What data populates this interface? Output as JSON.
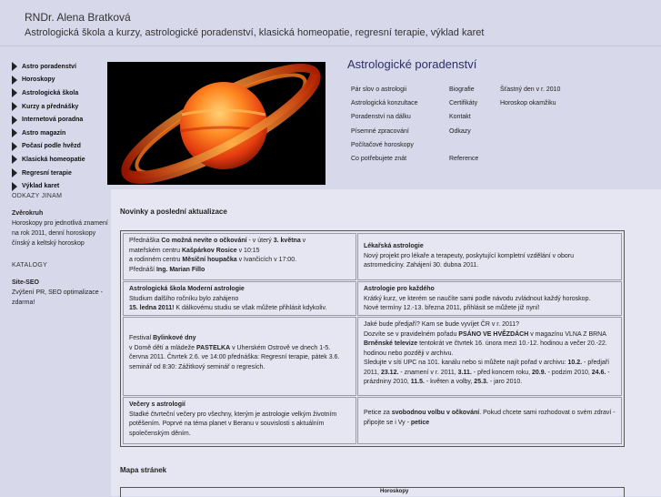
{
  "header": {
    "name": "RNDr. Alena Bratková",
    "tagline": "Astrologická škola a kurzy, astrologické poradenství, klasická homeopatie, regresní terapie, výklad karet"
  },
  "nav": [
    "Astro poradenství",
    "Horoskopy",
    "Astrologická škola",
    "Kurzy a přednášky",
    "Internetová poradna",
    "Astro magazín",
    "Počasí podle hvězd",
    "Klasická homeopatie",
    "Regresní terapie",
    "Výklad karet"
  ],
  "section": {
    "title": "Astrologické poradenství",
    "col1": [
      "Pár slov o astrologii",
      "Astrologická konzultace",
      "Poradenství na dálku",
      "Písemné zpracování",
      "Počítačové horoskopy",
      "Co potřebujete znát"
    ],
    "col2": [
      "Biografie",
      "Certifikáty",
      "Kontakt",
      "Odkazy",
      "",
      "Reference"
    ],
    "col3": [
      "Šťastný den v r. 2010",
      "Horoskop okamžiku"
    ]
  },
  "sidebar": {
    "heading1": "ODKAZY JINAM",
    "link1_title": "Zvěrokruh",
    "link1_text": "Horoskopy pro jednotlivá znamení na rok 2011, denní horoskopy čínský a keltský horoskop",
    "heading2": "KATALOGY",
    "link2_title": "Site-SEO",
    "link2_text": "Zvýšení PR, SEO optimalizace - zdarma!"
  },
  "main": {
    "news_title": "Novinky a poslední aktualizace",
    "sitemap_title": "Mapa stránek",
    "sitemap_col_label": "Horoskopy"
  },
  "news": {
    "c1": {
      "line1a": "Přednáška ",
      "line1b": "Co možná nevíte o očkování",
      "line1c": " - v úterý ",
      "line1d": "3. května",
      "line1e": " v",
      "line2a": "mateřském centru ",
      "line2b": "Kašpárkov Rosice",
      "line2c": " v 10:15",
      "line3a": "a rodinném centru ",
      "line3b": "Měsíční houpačka",
      "line3c": " v Ivančicích v 17:00.",
      "line4a": "Přednáší ",
      "line4b": "Ing. Marian Fillo"
    },
    "c2": {
      "title": "Lékařská astrologie",
      "text": "Nový projekt pro lékaře a terapeuty, poskytující kompletní vzdělání v oboru astromedicíny. Zahájení 30. dubna 2011."
    },
    "c3": {
      "title": "Astrologická škola Moderní astrologie",
      "text1": "Studium dalšího ročníku bylo zahájeno",
      "date": "15. ledna 2011!",
      "text2": " K dálkovému studiu se však můžete přihlásit kdykoliv."
    },
    "c4": {
      "title": "Astrologie pro každého",
      "text1": "Krátký kurz, ve kterém se naučíte sami podle návodu zvládnout každý horoskop.",
      "text2": "Nové termíny 12.-13. března 2011, přihlásit se můžete již nyní!"
    },
    "c5": {
      "a": "Festival ",
      "b": "Bylinkové dny",
      "c": "v Domě dětí a mládeže ",
      "d": "PASTELKA",
      "e": " v Uherském Ostrově ve dnech 1-5. června 2011. Čtvrtek 2.6. ve 14:00 přednáška: Regresní terapie, pátek 3.6. seminář od 8:30: Zážitkový seminář o regresích."
    },
    "c6": {
      "q": "Jaké bude předjaří? Kam se bude vyvíjet ČR v r. 2011?",
      "a1": "Dozvíte se v pravidelném pořadu ",
      "a2": "PSÁNO VE HVĚZDÁCH",
      "a3": " v magazínu VLNA Z BRNA ",
      "b1": "Brněnské televize",
      "b2": " tentokrát ve čtvrtek 16. února mezi 10.-12. hodinou a večer 20.-22. hodinou nebo později v archivu.",
      "c1": "Sledujte v síti UPC na 101. kanálu nebo si můžete najít pořad v archivu: ",
      "d1": "10.2.",
      "d2": " - předjaří 2011, ",
      "d3": "23.12.",
      "d4": " - znamení v r. 2011, ",
      "d5": "3.11.",
      "d6": " - před koncem roku, ",
      "d7": "20.9.",
      "d8": " - podzim 2010, ",
      "d9": "24.6.",
      "d10": " - prázdniny 2010, ",
      "d11": "11.5.",
      "d12": " - květen a volby, ",
      "d13": "25.3.",
      "d14": " - jaro 2010."
    },
    "c7": {
      "title": "Večery s astrologií",
      "text": "Stadké čtvrteční večery pro všechny, kterým je astrologie velkým životním potěšením. Poprvé na téma planet v Beranu v souvislosti s aktuálním společenským děním."
    },
    "c8": {
      "a": "Petice za ",
      "b": "svobodnou volbu v očkování",
      "c": ". Pokud chcete sami rozhodovat o svém zdraví - připojte se i Vy - ",
      "d": "petice"
    }
  }
}
